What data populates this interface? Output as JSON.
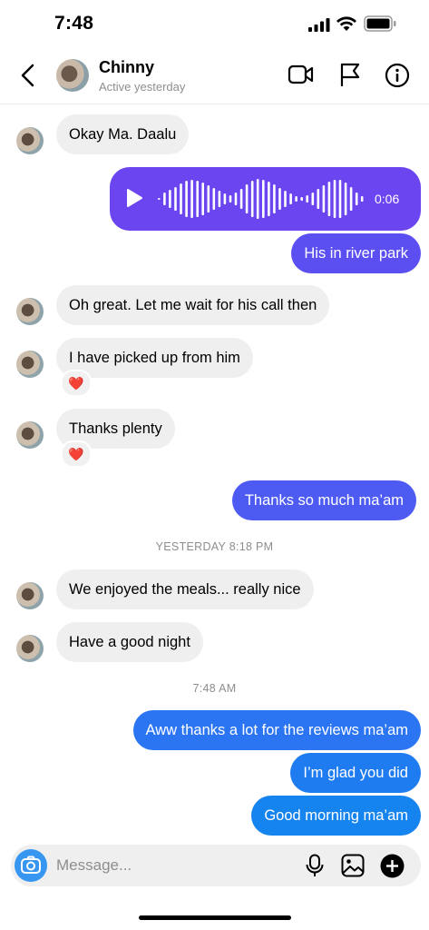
{
  "status_bar": {
    "time": "7:48"
  },
  "header": {
    "name": "Chinny",
    "status": "Active yesterday"
  },
  "messages": [
    {
      "text": "Okay Ma. Daalu"
    },
    {
      "voice_duration": "0:06"
    },
    {
      "text": "His in river park"
    },
    {
      "text": "Oh great.  Let me wait for his call then"
    },
    {
      "text": "I have picked up from him",
      "reaction": "❤️"
    },
    {
      "text": "Thanks plenty",
      "reaction": "❤️"
    },
    {
      "text": "Thanks so much ma’am"
    },
    {
      "timestamp": "YESTERDAY 8:18 PM"
    },
    {
      "text": "We enjoyed the meals... really nice"
    },
    {
      "text": "Have a good night"
    },
    {
      "timestamp": "7:48 AM"
    },
    {
      "text": "Aww thanks a lot for the reviews ma’am"
    },
    {
      "text": "I’m glad you did"
    },
    {
      "text": "Good morning ma’am"
    }
  ],
  "composer": {
    "placeholder": "Message..."
  },
  "colors": {
    "outgoing_purple": "#6b45f0",
    "outgoing_indigo": "#5b4ff2",
    "outgoing_blue": "#1f7cf0",
    "camera_blue": "#3797f0"
  },
  "icons": [
    "back-icon",
    "video-call-icon",
    "flag-icon",
    "info-icon",
    "play-icon",
    "camera-icon",
    "microphone-icon",
    "gallery-icon",
    "add-icon"
  ]
}
